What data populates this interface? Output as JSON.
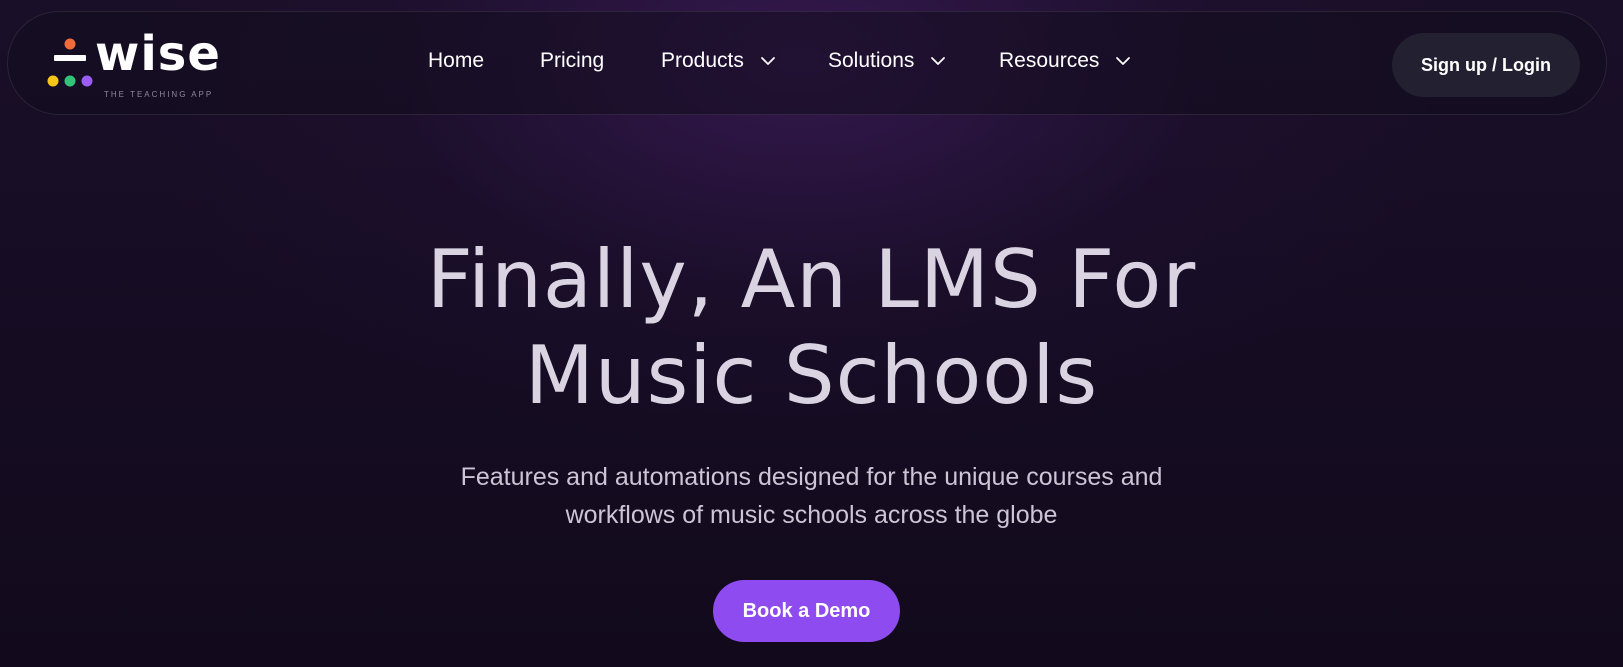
{
  "brand": {
    "name": "wise",
    "tagline": "THE TEACHING APP",
    "dot_colors": [
      "#f26b3a",
      "#f5c518",
      "#33c27a",
      "#9b5cf6"
    ]
  },
  "nav": {
    "items": [
      {
        "label": "Home",
        "has_dropdown": false
      },
      {
        "label": "Pricing",
        "has_dropdown": false
      },
      {
        "label": "Products",
        "has_dropdown": true,
        "icon": "chevron-down-icon"
      },
      {
        "label": "Solutions",
        "has_dropdown": true,
        "icon": "chevron-down-icon"
      },
      {
        "label": "Resources",
        "has_dropdown": true,
        "icon": "chevron-down-icon"
      }
    ],
    "cta_label": "Sign up / Login"
  },
  "hero": {
    "title_lines": [
      "Finally, An LMS For",
      "Music Schools"
    ],
    "subtitle_lines": [
      "Features and automations designed for the unique courses and",
      "workflows of music schools across the globe"
    ],
    "cta_label": "Book a Demo"
  },
  "colors": {
    "background": "#140b1f",
    "accent": "#8e4cf0",
    "nav_button_bg": "#232032"
  }
}
